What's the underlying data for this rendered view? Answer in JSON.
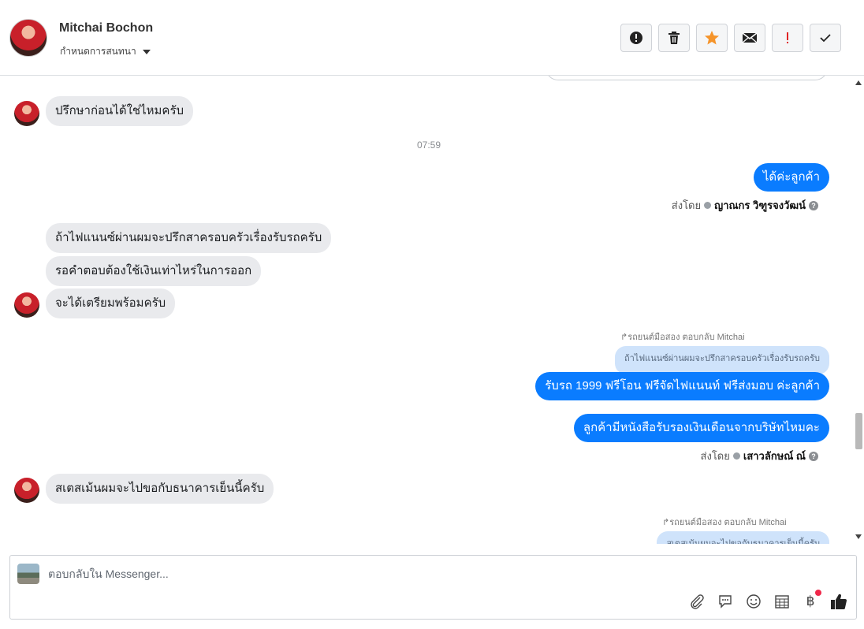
{
  "header": {
    "contact_name": "Mitchai Bochon",
    "label_select": "กำหนดการสนทนา",
    "toolbar": [
      "mark-spam",
      "delete",
      "star",
      "mark-unread",
      "mark-important",
      "mark-done"
    ]
  },
  "messages": {
    "m1": "ปรึกษาก่อนได้ใช่ไหมครับ",
    "time": "07:59",
    "m2": "ได้ค่ะลูกค้า",
    "sent_by_prefix": "ส่งโดย",
    "sent_by_1": "ญาณกร วิฑูรจงวัฒน์",
    "m3": "ถ้าไฟแนนซ์ผ่านผมจะปรึกสาครอบครัวเรื่องรับรถครับ",
    "m4": "รอคำตอบต้องใช้เงินเท่าไหร่ในการออก",
    "m5": "จะได้เตรียมพร้อมครับ",
    "reply_label_1": "รถยนต์มือสอง ตอบกลับ Mitchai",
    "quote_1": "ถ้าไฟแนนซ์ผ่านผมจะปรึกสาครอบครัวเรื่องรับรถครับ",
    "m6": "รับรถ 1999 ฟรีโอน ฟรีจัดไฟแนนท์ ฟรีส่งมอบ ค่ะลูกค้า",
    "m7": "ลูกค้ามีหนังสือรับรองเงินเดือนจากบริษัทไหมคะ",
    "sent_by_2": "เสาวลักษณ์ ณ์",
    "m8": "สเตสเม้นผมจะไปขอกับธนาคารเย็นนี้ครับ",
    "reply_label_2": "รถยนต์มือสอง ตอบกลับ Mitchai",
    "quote_2": "สเตสเม้นผมจะไปขอกับธนาคารเย็นนี้ครับ"
  },
  "composer": {
    "placeholder": "ตอบกลับใน Messenger...",
    "baht_symbol": "฿"
  },
  "colors": {
    "accent": "#0a7cff",
    "incoming": "#e9eaed",
    "quote": "#cfe3fb",
    "star": "#f5942a",
    "important": "#e02424"
  }
}
